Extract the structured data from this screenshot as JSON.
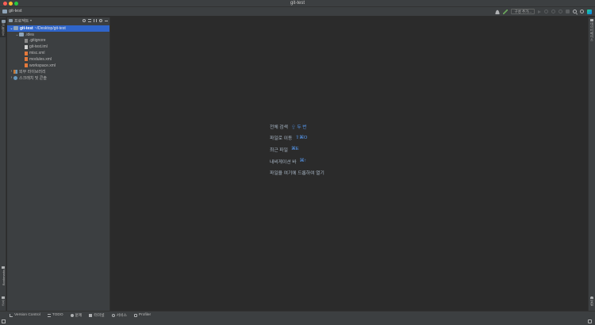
{
  "window": {
    "title": "git-test"
  },
  "navbar": {
    "project_name": "git-test",
    "run_config_label": "구성 추가..."
  },
  "left_stripe": {
    "project_label": "프로젝트",
    "bookmarks_label": "Bookmarks",
    "structure_label": "구조"
  },
  "right_stripe": {
    "database_label": "데이터베이스",
    "notifications_label": "알림"
  },
  "project_panel": {
    "title": "프로젝트",
    "tree": [
      {
        "name": "git-test",
        "path": "~/Desktop/git-test",
        "level": 0,
        "expanded": true,
        "type": "folder",
        "selected": true
      },
      {
        "name": ".idea",
        "level": 1,
        "expanded": true,
        "type": "folder"
      },
      {
        "name": ".gitignore",
        "level": 2,
        "type": "gitignore"
      },
      {
        "name": "git-test.iml",
        "level": 2,
        "type": "iml"
      },
      {
        "name": "misc.xml",
        "level": 2,
        "type": "xml"
      },
      {
        "name": "modules.xml",
        "level": 2,
        "type": "xml"
      },
      {
        "name": "workspace.xml",
        "level": 2,
        "type": "xml"
      },
      {
        "name": "외부 라이브러리",
        "level": 0,
        "expanded": false,
        "type": "library"
      },
      {
        "name": "스크래치 및 콘솔",
        "level": 0,
        "expanded": false,
        "type": "scratch"
      }
    ]
  },
  "editor_hints": [
    {
      "label": "전체 검색",
      "shortcut": "⇧ 두 번"
    },
    {
      "label": "파일로 이동",
      "shortcut": "⇧⌘O"
    },
    {
      "label": "최근 파일",
      "shortcut": "⌘E"
    },
    {
      "label": "내비게이션 바",
      "shortcut": "⌘↑"
    },
    {
      "label": "파일을 여기에 드롭하여 열기",
      "shortcut": ""
    }
  ],
  "statusbar": {
    "items": [
      {
        "label": "Version Control",
        "icon": "version-control-icon"
      },
      {
        "label": "TODO",
        "icon": "todo-icon"
      },
      {
        "label": "문제",
        "icon": "problems-icon"
      },
      {
        "label": "터미널",
        "icon": "terminal-icon"
      },
      {
        "label": "서비스",
        "icon": "services-icon"
      },
      {
        "label": "Profiler",
        "icon": "profiler-icon"
      }
    ]
  },
  "colors": {
    "selection": "#2f65ca",
    "shortcut": "#589df6",
    "background": "#2b2b2b",
    "panel": "#3c3f41"
  }
}
